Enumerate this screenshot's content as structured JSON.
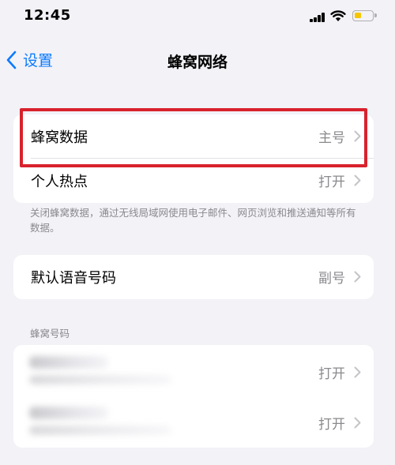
{
  "status_bar": {
    "time": "12:45"
  },
  "nav": {
    "back_label": "设置",
    "title": "蜂窝网络"
  },
  "group1": {
    "rows": [
      {
        "label": "蜂窝数据",
        "value": "主号"
      },
      {
        "label": "个人热点",
        "value": "打开"
      }
    ],
    "footnote": "关闭蜂窝数据，通过无线局域网使用电子邮件、网页浏览和推送通知等所有数据。"
  },
  "group2": {
    "rows": [
      {
        "label": "默认语音号码",
        "value": "副号"
      }
    ]
  },
  "cellular_numbers": {
    "header": "蜂窝号码",
    "rows": [
      {
        "value": "打开"
      },
      {
        "value": "打开"
      }
    ]
  },
  "colors": {
    "accent": "#0a7aff",
    "highlight": "#d8222c",
    "battery": "#f7c600"
  }
}
